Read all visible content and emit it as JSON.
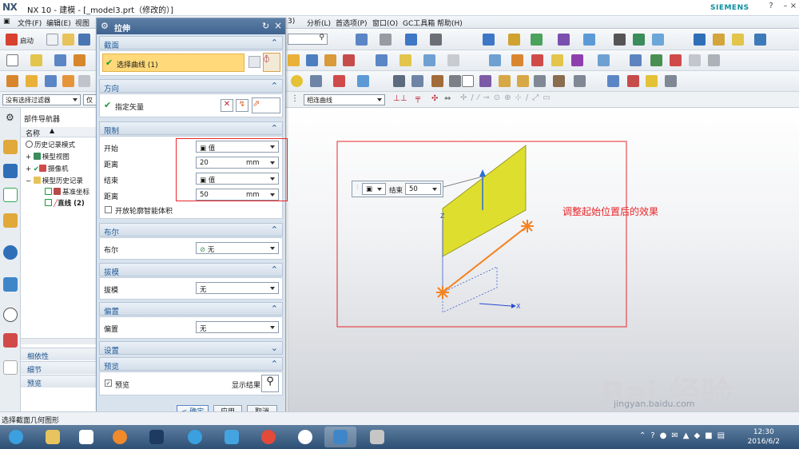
{
  "window": {
    "app": "NX",
    "title": "NX 10 - 建模 - [_model3.prt（修改的）]",
    "brand": "SIEMENS"
  },
  "menubar": {
    "items": [
      "文件(F)",
      "编辑(E)",
      "视图(V)",
      "分析(L)",
      "首选项(P)",
      "窗口(O)",
      "GC工具箱",
      "帮助(H)"
    ],
    "visible": [
      "文件(F)",
      "编辑(E)",
      "视图",
      "3)",
      "分析(L)",
      "首选项(P)",
      "窗口(O)",
      "GC工具箱",
      "帮助(H)"
    ]
  },
  "toolbar": {
    "start_label": "启动",
    "filter": "没有选择过滤器",
    "curve_rule": "相连曲线",
    "filter2": "仅"
  },
  "navigator": {
    "title": "部件导航器",
    "column_name": "名称",
    "items": [
      {
        "label": "历史记录模式",
        "level": 1
      },
      {
        "label": "模型视图",
        "level": 1
      },
      {
        "label": "摄像机",
        "level": 1
      },
      {
        "label": "模型历史记录",
        "level": 1
      },
      {
        "label": "基准坐标",
        "level": 2
      },
      {
        "label": "直线 (2)",
        "level": 2
      }
    ],
    "footer": [
      "相依性",
      "细节",
      "预览"
    ]
  },
  "dialog": {
    "title": "拉伸",
    "sections": {
      "section": {
        "header": "截面",
        "select_curve": "选择曲线 (1)"
      },
      "direction": {
        "header": "方向",
        "vector": "指定矢量"
      },
      "limits": {
        "header": "限制",
        "start_label": "开始",
        "start_value": "值",
        "distance1_label": "距离",
        "distance1": "20",
        "end_label": "结束",
        "end_value": "值",
        "distance2_label": "距离",
        "distance2": "50",
        "unit": "mm",
        "open_profile": "开放轮廓智能体积"
      },
      "boolean": {
        "header": "布尔",
        "label": "布尔",
        "value": "无"
      },
      "draft": {
        "header": "拔模",
        "label": "拔模",
        "value": "无"
      },
      "offset": {
        "header": "偏置",
        "label": "偏置",
        "value": "无"
      },
      "settings": {
        "header": "设置"
      },
      "preview": {
        "header": "预览",
        "preview_label": "预览",
        "show_result": "显示结果"
      }
    },
    "buttons": {
      "ok": "< 确定 >",
      "apply": "应用",
      "cancel": "取消"
    }
  },
  "graphics": {
    "screen_label": "结束",
    "screen_value": "50",
    "annotation": "调整起始位置后的效果",
    "axis_x": "X",
    "axis_z": "Z"
  },
  "statusbar": {
    "message": "选择截面几何图形"
  },
  "taskbar": {
    "time": "12:30",
    "date": "2016/6/2"
  },
  "watermark": {
    "brand": "Bai 经验",
    "url": "jingyan.baidu.com"
  },
  "colors": {
    "accent": "#3f6390",
    "face": "#dede2e",
    "highlight": "#ffd97a",
    "annotation": "#e8262a",
    "orange": "#f58220"
  }
}
